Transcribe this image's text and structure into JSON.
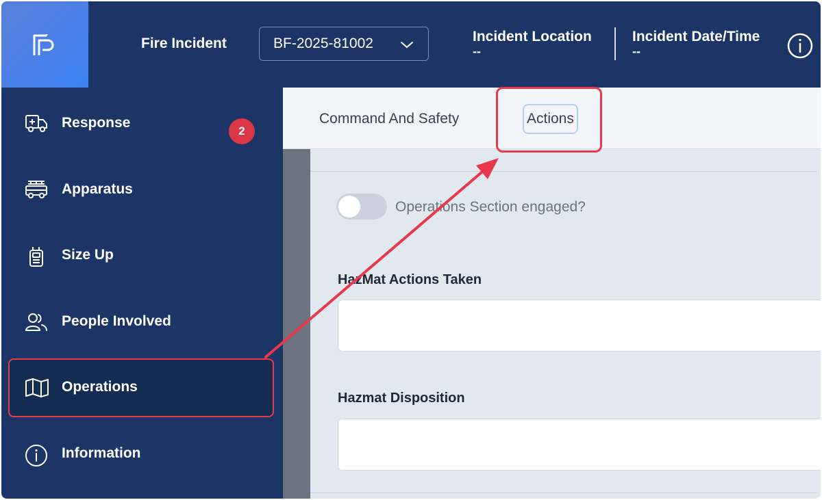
{
  "header": {
    "app_title": "Fire Incident",
    "incident_id": "BF-2025-81002",
    "location_label": "Incident Location",
    "location_value": "--",
    "datetime_label": "Incident Date/Time",
    "datetime_value": "--"
  },
  "sidebar": {
    "items": [
      {
        "label": "Response",
        "icon": "ambulance-icon",
        "badge": "2"
      },
      {
        "label": "Apparatus",
        "icon": "fire-truck-icon"
      },
      {
        "label": "Size Up",
        "icon": "radio-icon"
      },
      {
        "label": "People Involved",
        "icon": "people-icon"
      },
      {
        "label": "Operations",
        "icon": "map-icon",
        "active": true
      },
      {
        "label": "Information",
        "icon": "info-icon"
      }
    ]
  },
  "main": {
    "tabs": [
      {
        "label": "Command And Safety"
      },
      {
        "label": "Actions",
        "active": true
      }
    ],
    "toggle": {
      "label": "Operations Section engaged?",
      "on": false
    },
    "fields": [
      {
        "label": "HazMat Actions Taken",
        "value": ""
      },
      {
        "label": "Hazmat Disposition",
        "value": ""
      }
    ]
  },
  "colors": {
    "navy": "#1d3566",
    "accent_red": "#e8394a",
    "badge_red": "#dc3545",
    "content_bg": "#e2e8f0"
  }
}
